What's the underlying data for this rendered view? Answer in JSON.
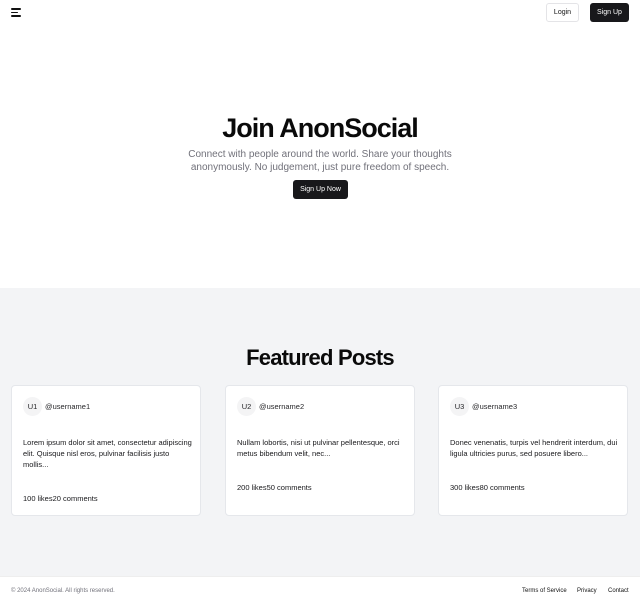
{
  "header": {
    "menu_icon": "hamburger-menu-icon",
    "login_label": "Login",
    "signup_label": "Sign Up"
  },
  "hero": {
    "title": "Join AnonSocial",
    "subtitle": "Connect with people around the world. Share your thoughts anonymously. No judgement, just pure freedom of speech.",
    "cta_label": "Sign Up Now"
  },
  "featured": {
    "title": "Featured Posts",
    "posts": [
      {
        "avatar": "U1",
        "username": "@username1",
        "text": "Lorem ipsum dolor sit amet, consectetur adipiscing elit. Quisque nisl eros, pulvinar facilisis justo mollis...",
        "likes": "100 likes",
        "comments": "20 comments"
      },
      {
        "avatar": "U2",
        "username": "@username2",
        "text": "Nullam lobortis, nisi ut pulvinar pellentesque, orci metus bibendum velit, nec...",
        "likes": "200 likes",
        "comments": "50 comments"
      },
      {
        "avatar": "U3",
        "username": "@username3",
        "text": "Donec venenatis, turpis vel hendrerit interdum, dui ligula ultricies purus, sed posuere libero...",
        "likes": "300 likes",
        "comments": "80 comments"
      }
    ]
  },
  "footer": {
    "copyright": "© 2024 AnonSocial. All rights reserved.",
    "links": [
      "Terms of Service",
      "Privacy",
      "Contact"
    ]
  },
  "colors": {
    "primary_button": "#18181b",
    "featured_background": "#f3f4f6",
    "muted_text": "#71717a"
  }
}
